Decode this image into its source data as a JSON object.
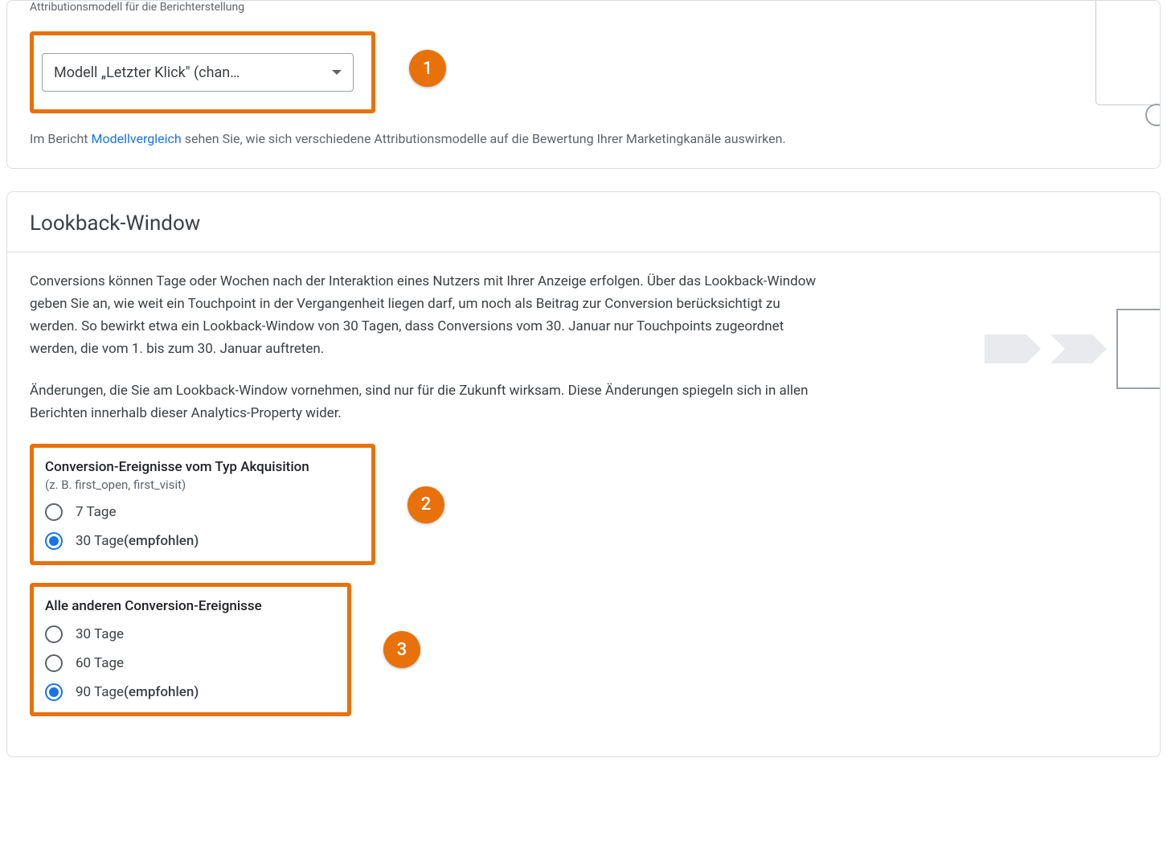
{
  "attribution": {
    "section_label": "Attributionsmodell für die Berichterstellung",
    "dropdown_value": "Modell „Letzter Klick\" (chan…",
    "description_prefix": "Im Bericht ",
    "description_link": "Modellvergleich",
    "description_suffix": " sehen Sie, wie sich verschiedene Attributionsmodelle auf die Bewertung Ihrer Marketingkanäle auswirken."
  },
  "lookback": {
    "heading": "Lookback-Window",
    "para1": "Conversions können Tage oder Wochen nach der Interaktion eines Nutzers mit Ihrer Anzeige erfolgen. Über das Lookback-Window geben Sie an, wie weit ein Touchpoint in der Vergangenheit liegen darf, um noch als Beitrag zur Conversion berücksichtigt zu werden. So bewirkt etwa ein Lookback-Window von 30 Tagen, dass Conversions vom 30. Januar nur Touchpoints zugeordnet werden, die vom 1. bis zum 30. Januar auftreten.",
    "para2": "Änderungen, die Sie am Lookback-Window vornehmen, sind nur für die Zukunft wirksam. Diese Änderungen spiegeln sich in allen Berichten innerhalb dieser Analytics-Property wider.",
    "acquisition": {
      "title": "Conversion-Ereignisse vom Typ Akquisition",
      "subtitle": "(z. B. first_open, first_visit)",
      "options": [
        {
          "label": "7 Tage",
          "recommended": "",
          "selected": false
        },
        {
          "label": "30 Tage ",
          "recommended": "(empfohlen)",
          "selected": true
        }
      ]
    },
    "other": {
      "title": "Alle anderen Conversion-Ereignisse",
      "options": [
        {
          "label": "30 Tage",
          "recommended": "",
          "selected": false
        },
        {
          "label": "60 Tage",
          "recommended": "",
          "selected": false
        },
        {
          "label": "90 Tage ",
          "recommended": "(empfohlen)",
          "selected": true
        }
      ]
    }
  },
  "callouts": {
    "c1": "1",
    "c2": "2",
    "c3": "3"
  }
}
